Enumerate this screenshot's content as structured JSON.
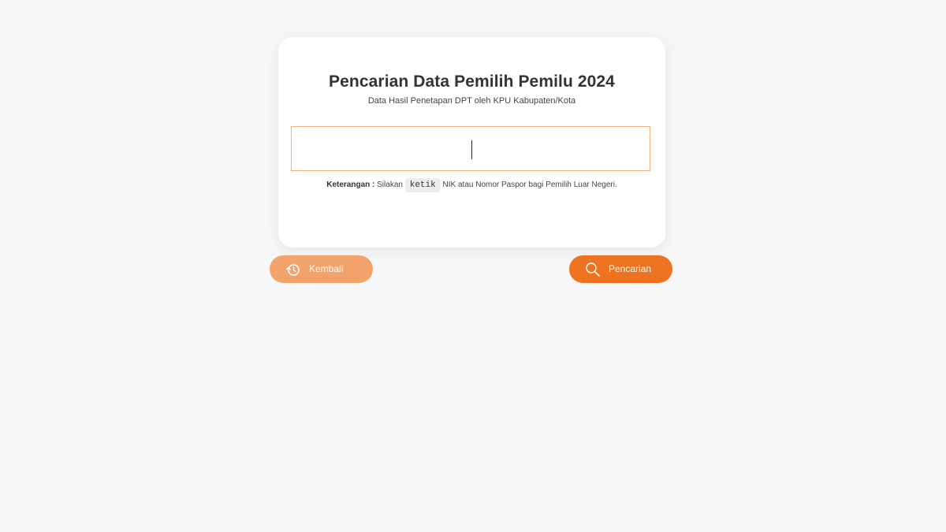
{
  "page": {
    "title": "Pencarian Data Pemilih Pemilu 2024",
    "subtitle": "Data Hasil Penetapan DPT oleh KPU Kabupaten/Kota"
  },
  "search": {
    "value": "",
    "placeholder": ""
  },
  "note": {
    "label": "Keterangan :",
    "prefix": "Silakan",
    "code": "ketik",
    "suffix": "NIK atau Nomor Paspor bagi Pemilih Luar Negeri."
  },
  "buttons": {
    "back_label": "Kembali",
    "back_icon": "history-back-icon",
    "search_label": "Pencarian",
    "search_icon": "search-icon"
  },
  "colors": {
    "accent": "#ee7320",
    "accent_light": "#f2a36b",
    "input_border": "#f3b07c",
    "background": "#f7f7f7"
  }
}
